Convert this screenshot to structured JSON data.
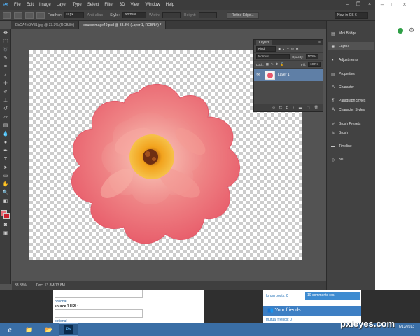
{
  "menubar": {
    "app_logo": "Ps",
    "items": [
      "File",
      "Edit",
      "Image",
      "Layer",
      "Type",
      "Select",
      "Filter",
      "3D",
      "View",
      "Window",
      "Help"
    ]
  },
  "options_bar": {
    "feather_label": "Feather:",
    "feather_value": "0 px",
    "antialias_label": "Anti-alias",
    "style_label": "Style:",
    "style_value": "Normal",
    "width_label": "Width:",
    "height_label": "Height:",
    "refine_button": "Refine Edge...",
    "workspace": "New in CS 6"
  },
  "doc_tabs": [
    {
      "label": "EbCA4M3Y31.jpg @ 33.3% (RGB/8#)",
      "active": false
    },
    {
      "label": "sourceimage49.psd @ 33.3% (Layer 1, RGB/8#) *",
      "active": true
    }
  ],
  "layers_panel": {
    "title": "Layers",
    "kind_label": "Kind",
    "blend_mode": "Normal",
    "opacity_label": "Opacity:",
    "opacity_value": "100%",
    "lock_label": "Lock:",
    "fill_label": "Fill:",
    "fill_value": "100%",
    "layer_name": "Layer 1",
    "footer_icons": [
      "link-icon",
      "fx-icon",
      "mask-icon",
      "adjustment-icon",
      "folder-icon",
      "new-layer-icon",
      "trash-icon"
    ]
  },
  "dock": {
    "items": [
      "Mini Bridge",
      "Layers",
      "Adjustments",
      "Properties",
      "Character",
      "Paragraph Styles",
      "Character Styles",
      "Brush Presets",
      "Brush",
      "Timeline",
      "3D"
    ],
    "selected": "Layers"
  },
  "statusbar": {
    "zoom": "33.33%",
    "doc": "Doc: 13.8M/13.8M"
  },
  "browser": {
    "form": {
      "label_optional_1": "optional",
      "label_source_url": "source 1 URL:",
      "label_optional_2": "optional"
    },
    "sidebar": {
      "forum_posts": "forum posts: 0",
      "comments_button": "10 comments rec.",
      "your_friends": "Your friends",
      "mutual_friends": "mutual friends: 0"
    }
  },
  "taskbar": {
    "clock_date": "6/13/2013"
  },
  "watermark": "pxleyes.com",
  "colors": {
    "foreground": "#e86e7a",
    "background": "#cc1f2e",
    "accent_blue": "#3d8bd1"
  }
}
